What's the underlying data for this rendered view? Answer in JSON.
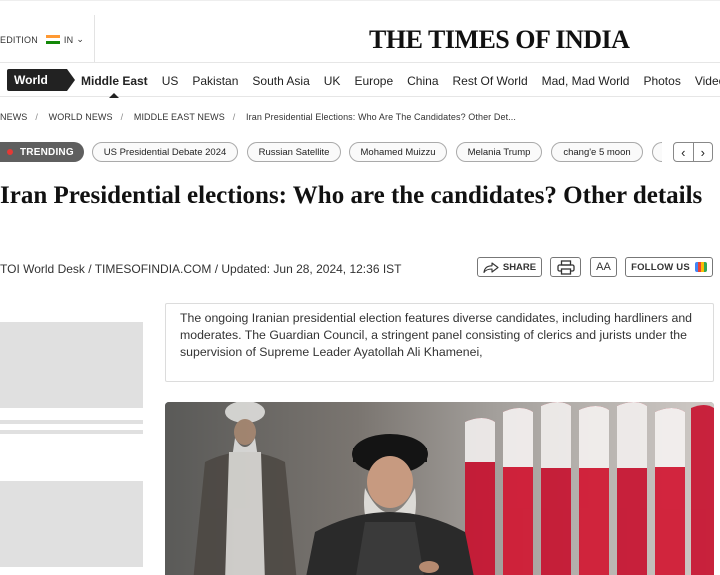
{
  "header": {
    "edition_label": "EDITION",
    "edition_code": "IN",
    "logo": "THE TIMES OF INDIA",
    "flag_colors": [
      "#ff9933",
      "#ffffff",
      "#138808"
    ]
  },
  "nav": {
    "section": "World",
    "links": [
      "Middle East",
      "US",
      "Pakistan",
      "South Asia",
      "UK",
      "Europe",
      "China",
      "Rest Of World",
      "Mad, Mad World",
      "Photos",
      "Videos"
    ],
    "active": "Middle East"
  },
  "breadcrumb": [
    "NEWS",
    "WORLD NEWS",
    "MIDDLE EAST NEWS",
    "Iran Presidential Elections: Who Are The Candidates? Other Det..."
  ],
  "trending": {
    "label": "TRENDING",
    "topics": [
      "US Presidential Debate 2024",
      "Russian Satellite",
      "Mohamed Muizzu",
      "Melania Trump",
      "chang'e 5 moon"
    ],
    "prev": "‹",
    "next": "›"
  },
  "article": {
    "headline": "Iran Presidential elections: Who are the candidates? Other details",
    "byline": "TOI World Desk / TIMESOFINDIA.COM / Updated: Jun 28, 2024, 12:36 IST",
    "summary": "The ongoing Iranian presidential election features diverse candidates, including hardliners and moderates. The Guardian Council, a stringent panel consisting of clerics and jurists under the supervision of Supreme Leader Ayatollah Ali Khamenei,"
  },
  "actions": {
    "share": "SHARE",
    "font_size": "AA",
    "follow": "FOLLOW US",
    "icons": [
      "share-icon",
      "print-icon",
      "google-news-icon"
    ]
  },
  "colors": {
    "trending_bg": "#5f5f5f",
    "trending_dot": "#e53935",
    "nav_section_bg": "#222222"
  }
}
